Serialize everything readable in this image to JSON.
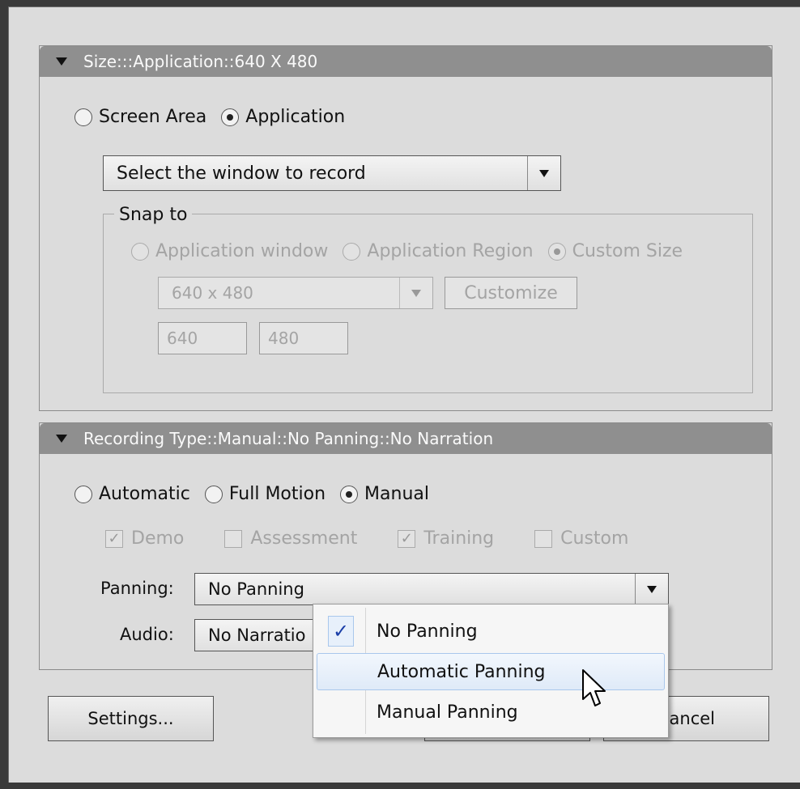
{
  "size_section": {
    "header": "Size:::Application::640 X 480",
    "radio_screen_area": "Screen Area",
    "radio_application": "Application",
    "window_combo_value": "Select the window to record",
    "snap_to": {
      "legend": "Snap to",
      "radio_app_window": "Application window",
      "radio_app_region": "Application Region",
      "radio_custom_size": "Custom Size",
      "size_combo_value": "640 x 480",
      "customize_label": "Customize",
      "width_value": "640",
      "height_value": "480"
    }
  },
  "recording_section": {
    "header": "Recording Type::Manual::No Panning::No Narration",
    "radio_automatic": "Automatic",
    "radio_full_motion": "Full Motion",
    "radio_manual": "Manual",
    "check_demo": "Demo",
    "check_assessment": "Assessment",
    "check_training": "Training",
    "check_custom": "Custom",
    "panning_label": "Panning:",
    "panning_value": "No Panning",
    "audio_label": "Audio:",
    "audio_value": "No Narratio"
  },
  "panning_menu": {
    "items": [
      "No Panning",
      "Automatic Panning",
      "Manual Panning"
    ],
    "checkmark": "✓"
  },
  "footer": {
    "settings_label": "Settings...",
    "cancel_label": "ancel"
  }
}
